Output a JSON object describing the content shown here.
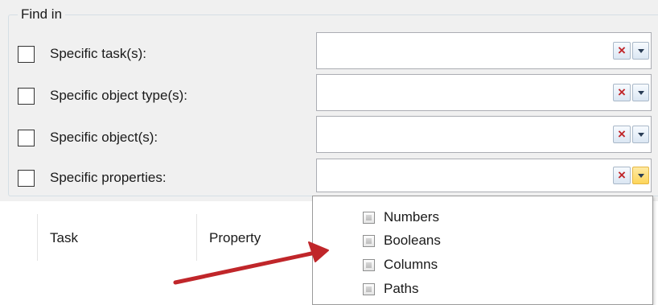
{
  "find_in": {
    "legend": "Find in",
    "rows": [
      {
        "label": "Specific task(s):",
        "checked": false,
        "value": ""
      },
      {
        "label": "Specific object type(s):",
        "checked": false,
        "value": ""
      },
      {
        "label": "Specific object(s):",
        "checked": false,
        "value": ""
      },
      {
        "label": "Specific properties:",
        "checked": false,
        "value": ""
      }
    ],
    "clear_glyph": "×"
  },
  "grid": {
    "columns": [
      "Task",
      "Property"
    ]
  },
  "dropdown": {
    "open_for": "Specific properties:",
    "options": [
      {
        "label": "Numbers",
        "state": "indeterminate"
      },
      {
        "label": "Booleans",
        "state": "indeterminate"
      },
      {
        "label": "Columns",
        "state": "indeterminate"
      },
      {
        "label": "Paths",
        "state": "indeterminate"
      }
    ]
  },
  "colors": {
    "arrow": "#c0262a",
    "clear_x": "#c0262a",
    "active_drop": "#fdd65a"
  }
}
